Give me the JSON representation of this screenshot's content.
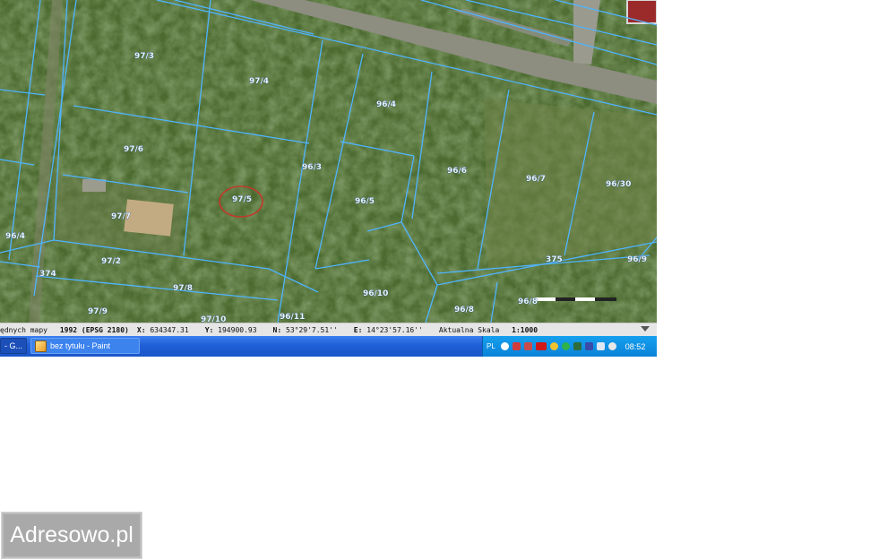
{
  "map": {
    "parcel_labels": [
      "97/3",
      "97/4",
      "96/4",
      "97/6",
      "96/3",
      "97/5",
      "96/5",
      "96/6",
      "96/7",
      "96/30",
      "97/7",
      "96/4",
      "374",
      "97/2",
      "375",
      "96/9",
      "97/8",
      "96/10",
      "97/9",
      "97/10",
      "96/11",
      "96/8",
      "96/8"
    ],
    "marked_parcel": "97/5",
    "colors": {
      "parcel_lines": "#4fb4ff",
      "marker": "#c0392b",
      "vegetation": "#4c6b30",
      "road": "#8d8d80"
    }
  },
  "statusbar": {
    "crs_prefix": "ędnych mapy",
    "crs_value": "1992 (EPSG 2180)",
    "x_label": "X:",
    "x_value": "634347.31",
    "y_label": "Y:",
    "y_value": "194900.93",
    "n_label": "N:",
    "n_value": "53°29'7.51''",
    "e_label": "E:",
    "e_value": "14°23'57.16''",
    "scale_label": "Aktualna Skala",
    "scale_value": "1:1000"
  },
  "taskbar": {
    "first_task": "- G...",
    "paint_task": "bez tytułu - Paint",
    "language": "PL",
    "clock": "08:52",
    "tray_icons": [
      "back-icon",
      "speaker-icon",
      "network-icon",
      "ati-icon",
      "chrome-icon",
      "green-icon",
      "display-icon",
      "user-icon",
      "volume-icon",
      "connection-icon"
    ]
  },
  "badge": {
    "text": "Adresowo.pl"
  }
}
